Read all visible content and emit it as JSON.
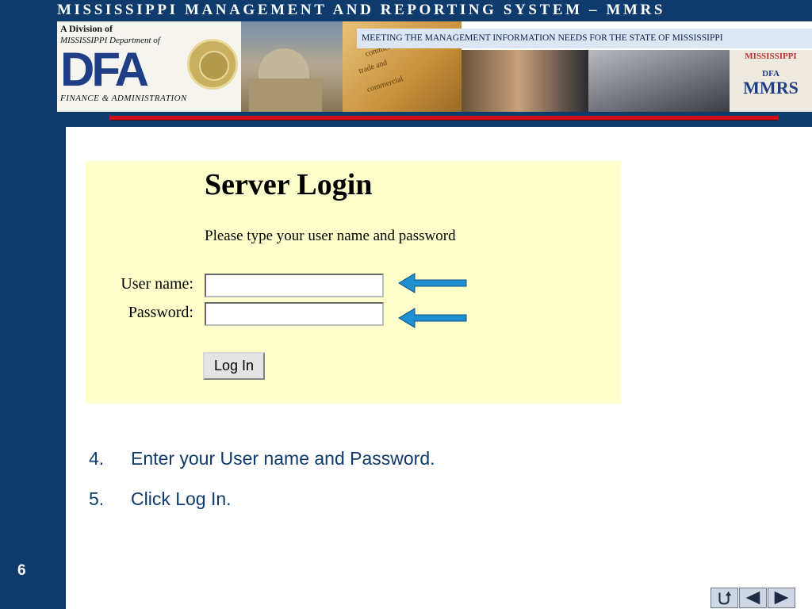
{
  "header": {
    "title": "MISSISSIPPI MANAGEMENT AND REPORTING SYSTEM – MMRS",
    "division_label": "A Division of",
    "department_label": "MISSISSIPPI Department of",
    "dfa_logo_text": "DFA",
    "finance_admin_label": "FINANCE & ADMINISTRATION",
    "tagline": "MEETING THE MANAGEMENT INFORMATION NEEDS FOR THE STATE OF MISSISSIPPI",
    "mmrs_logo": {
      "state": "MISSISSIPPI",
      "dfa": "DFA",
      "system": "MMRS"
    }
  },
  "login": {
    "title": "Server Login",
    "instructions": "Please type your user name and password",
    "username_label": "User name:",
    "username_value": "",
    "password_label": "Password:",
    "password_value": "",
    "button_label": "Log In"
  },
  "steps": [
    {
      "number": "4.",
      "text": "Enter your User name and Password."
    },
    {
      "number": "5.",
      "text": "Click Log In."
    }
  ],
  "slide": {
    "number": "6"
  },
  "navigation": {
    "icons": [
      "return-icon",
      "previous-slide-icon",
      "next-slide-icon"
    ]
  },
  "colors": {
    "sidebar": "#0e3a6c",
    "login_background": "#ffffcc",
    "rule_red": "#d01018",
    "arrow_blue": "#1e8fd0",
    "step_text": "#0e3a6c"
  }
}
